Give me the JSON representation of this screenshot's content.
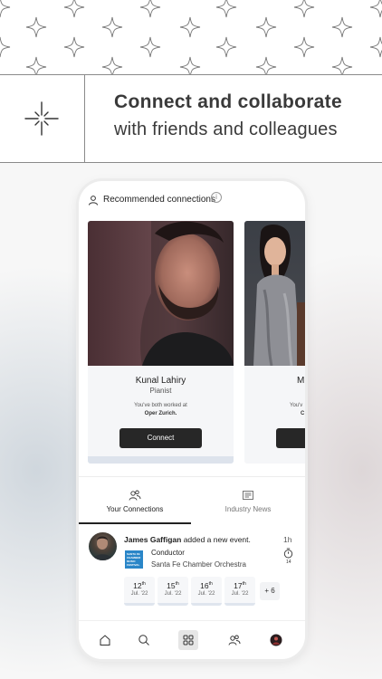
{
  "header": {
    "tagline_main": "Connect and collaborate",
    "tagline_sub": "with friends and colleagues"
  },
  "recommended": {
    "title": "Recommended connections",
    "info_icon": "i",
    "cards": [
      {
        "name": "Kunal Lahiry",
        "role": "Pianist",
        "note": "You've both worked at",
        "place": "Oper Zurich.",
        "button": "Connect"
      },
      {
        "name": "M",
        "note": "You'v",
        "place": "C",
        "button": ""
      }
    ]
  },
  "tabs": [
    {
      "label": "Your Connections",
      "icon": "people-icon",
      "active": true
    },
    {
      "label": "Industry News",
      "icon": "newspaper-icon",
      "active": false
    }
  ],
  "feed": {
    "user": "James Gaffigan",
    "action": "added a new event.",
    "time": "1h",
    "event_logo_text": "SANTA FE CHAMBER MUSIC FESTIVAL",
    "role": "Conductor",
    "org": "Santa Fe Chamber Orchestra",
    "timer_count": "14",
    "dates": [
      {
        "day": "12",
        "suffix": "th",
        "month": "Jul. '22"
      },
      {
        "day": "15",
        "suffix": "th",
        "month": "Jul. '22"
      },
      {
        "day": "16",
        "suffix": "th",
        "month": "Jul. '22"
      },
      {
        "day": "17",
        "suffix": "th",
        "month": "Jul. '22"
      }
    ],
    "more": "+ 6"
  },
  "nav": [
    "home-icon",
    "search-icon",
    "grid-icon",
    "people-icon",
    "profile-avatar"
  ],
  "colors": {
    "button_dark": "#272727",
    "event_logo_blue": "#2a86c8",
    "rule_gray": "#8a8a8a"
  }
}
